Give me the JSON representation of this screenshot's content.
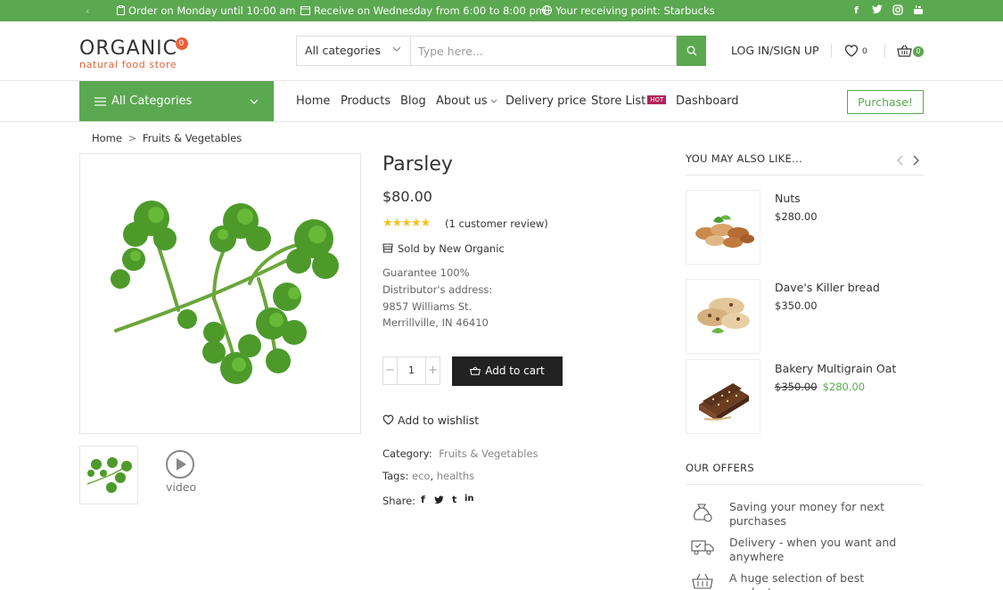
{
  "topbar": {
    "order": "Order on Monday until 10:00 am",
    "receive": "Receive on Wednesday from 6:00 to 8:00 pm",
    "point": "Your receiving point: Starbucks",
    "social_icons": [
      "facebook-icon",
      "twitter-icon",
      "instagram-icon",
      "youtube-icon"
    ]
  },
  "header": {
    "logo_main": "ORGANIC",
    "logo_badge": "0",
    "logo_sub": "natural food store",
    "search_category": "All categories",
    "search_placeholder": "Type here...",
    "login": "LOG IN/SIGN UP",
    "wishlist_count": "0",
    "cart_count": "0"
  },
  "nav": {
    "all_categories": "All Categories",
    "links": [
      "Home",
      "Products",
      "Blog",
      "About us",
      "Delivery price",
      "Store List",
      "Dashboard"
    ],
    "hot_badge": "HOT",
    "purchase": "Purchase!"
  },
  "breadcrumb": {
    "home": "Home",
    "sep": ">",
    "current": "Fruits & Vegetables"
  },
  "product": {
    "title": "Parsley",
    "price": "$80.00",
    "rating": 5,
    "reviews": "(1 customer review)",
    "sold_by": "Sold by New Organic",
    "guarantee": "Guarantee 100%",
    "distributor_label": "Distributor's address:",
    "address_line1": "9857 Williams St.",
    "address_line2": "Merrillville, IN 46410",
    "quantity": "1",
    "add_to_cart": "Add to cart",
    "wishlist": "Add to wishlist",
    "category_label": "Category:",
    "category_value": "Fruits & Vegetables",
    "tags_label": "Tags:",
    "tag1": "eco",
    "tag2": "healths",
    "share_label": "Share:",
    "video_label": "video"
  },
  "related": {
    "heading": "YOU MAY ALSO LIKE...",
    "items": [
      {
        "name": "Nuts",
        "price": "$280.00"
      },
      {
        "name": "Dave's Killer bread",
        "price": "$350.00"
      },
      {
        "name": "Bakery Multigrain Oat",
        "old_price": "$350.00",
        "price": "$280.00"
      }
    ]
  },
  "offers": {
    "heading": "OUR OFFERS",
    "items": [
      "Saving your money for next purchases",
      "Delivery - when you want and anywhere",
      "A huge selection of best products"
    ]
  },
  "colors": {
    "brand_green": "#5aa84f",
    "logo_orange": "#e8623a",
    "hot_badge": "#b5235e",
    "star": "#f4c21b"
  }
}
